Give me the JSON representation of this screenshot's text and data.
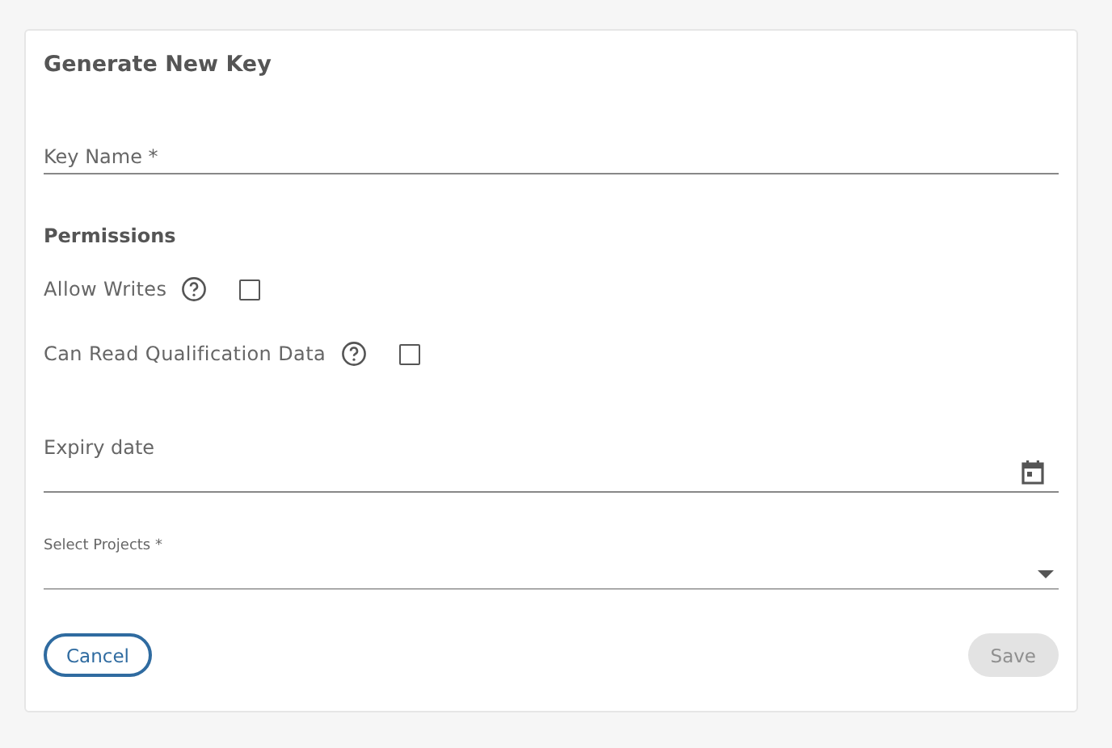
{
  "dialog": {
    "title": "Generate New Key"
  },
  "key_name": {
    "placeholder": "Key Name *"
  },
  "permissions": {
    "heading": "Permissions",
    "items": [
      {
        "label": "Allow Writes",
        "checked": false
      },
      {
        "label": "Can Read Qualification Data",
        "checked": false
      }
    ]
  },
  "expiry": {
    "placeholder": "Expiry date"
  },
  "projects": {
    "label": "Select Projects *"
  },
  "buttons": [
    {
      "label": "Cancel",
      "kind": "outlined",
      "disabled": false
    },
    {
      "label": "Save",
      "kind": "filled",
      "disabled": true
    }
  ]
}
